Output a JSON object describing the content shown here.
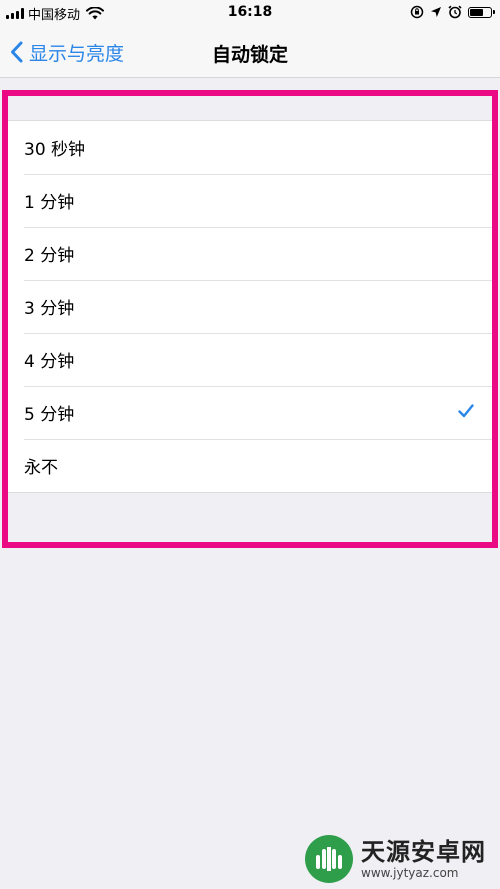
{
  "status_bar": {
    "carrier": "中国移动",
    "time": "16:18"
  },
  "nav": {
    "back_label": "显示与亮度",
    "title": "自动锁定"
  },
  "options": [
    {
      "label": "30 秒钟",
      "selected": false
    },
    {
      "label": "1 分钟",
      "selected": false
    },
    {
      "label": "2 分钟",
      "selected": false
    },
    {
      "label": "3 分钟",
      "selected": false
    },
    {
      "label": "4 分钟",
      "selected": false
    },
    {
      "label": "5 分钟",
      "selected": true
    },
    {
      "label": "永不",
      "selected": false
    }
  ],
  "watermark": {
    "name": "天源安卓网",
    "url": "www.jytyaz.com"
  },
  "colors": {
    "accent": "#2a86e8",
    "highlight": "#ea0a84",
    "background": "#efeff4"
  }
}
